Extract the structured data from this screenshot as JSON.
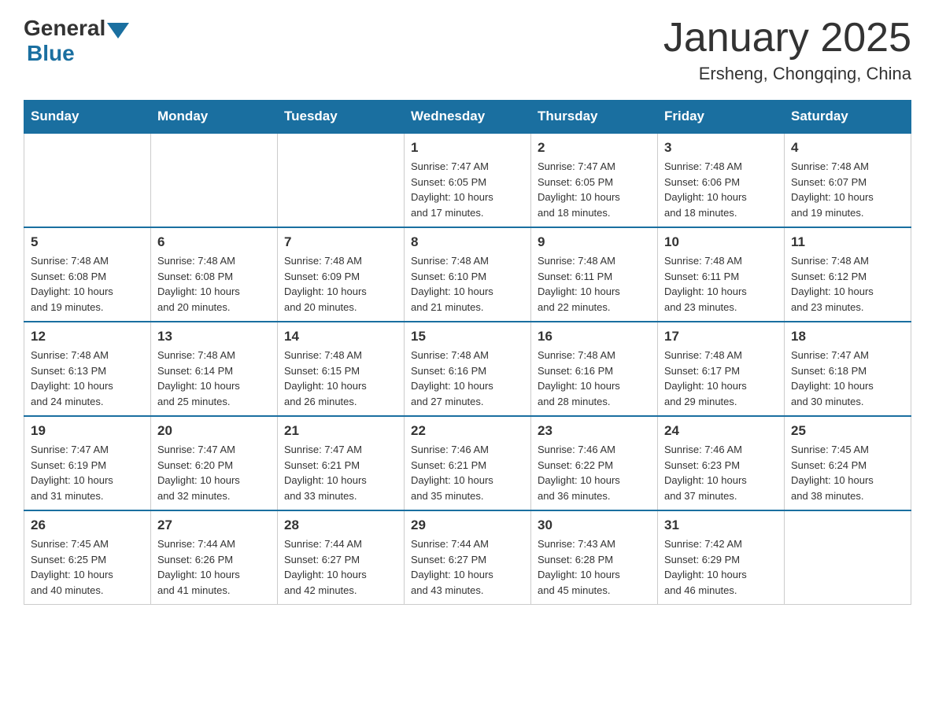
{
  "header": {
    "logo_general": "General",
    "logo_blue": "Blue",
    "title": "January 2025",
    "subtitle": "Ersheng, Chongqing, China"
  },
  "weekdays": [
    "Sunday",
    "Monday",
    "Tuesday",
    "Wednesday",
    "Thursday",
    "Friday",
    "Saturday"
  ],
  "weeks": [
    [
      {
        "day": "",
        "info": ""
      },
      {
        "day": "",
        "info": ""
      },
      {
        "day": "",
        "info": ""
      },
      {
        "day": "1",
        "info": "Sunrise: 7:47 AM\nSunset: 6:05 PM\nDaylight: 10 hours\nand 17 minutes."
      },
      {
        "day": "2",
        "info": "Sunrise: 7:47 AM\nSunset: 6:05 PM\nDaylight: 10 hours\nand 18 minutes."
      },
      {
        "day": "3",
        "info": "Sunrise: 7:48 AM\nSunset: 6:06 PM\nDaylight: 10 hours\nand 18 minutes."
      },
      {
        "day": "4",
        "info": "Sunrise: 7:48 AM\nSunset: 6:07 PM\nDaylight: 10 hours\nand 19 minutes."
      }
    ],
    [
      {
        "day": "5",
        "info": "Sunrise: 7:48 AM\nSunset: 6:08 PM\nDaylight: 10 hours\nand 19 minutes."
      },
      {
        "day": "6",
        "info": "Sunrise: 7:48 AM\nSunset: 6:08 PM\nDaylight: 10 hours\nand 20 minutes."
      },
      {
        "day": "7",
        "info": "Sunrise: 7:48 AM\nSunset: 6:09 PM\nDaylight: 10 hours\nand 20 minutes."
      },
      {
        "day": "8",
        "info": "Sunrise: 7:48 AM\nSunset: 6:10 PM\nDaylight: 10 hours\nand 21 minutes."
      },
      {
        "day": "9",
        "info": "Sunrise: 7:48 AM\nSunset: 6:11 PM\nDaylight: 10 hours\nand 22 minutes."
      },
      {
        "day": "10",
        "info": "Sunrise: 7:48 AM\nSunset: 6:11 PM\nDaylight: 10 hours\nand 23 minutes."
      },
      {
        "day": "11",
        "info": "Sunrise: 7:48 AM\nSunset: 6:12 PM\nDaylight: 10 hours\nand 23 minutes."
      }
    ],
    [
      {
        "day": "12",
        "info": "Sunrise: 7:48 AM\nSunset: 6:13 PM\nDaylight: 10 hours\nand 24 minutes."
      },
      {
        "day": "13",
        "info": "Sunrise: 7:48 AM\nSunset: 6:14 PM\nDaylight: 10 hours\nand 25 minutes."
      },
      {
        "day": "14",
        "info": "Sunrise: 7:48 AM\nSunset: 6:15 PM\nDaylight: 10 hours\nand 26 minutes."
      },
      {
        "day": "15",
        "info": "Sunrise: 7:48 AM\nSunset: 6:16 PM\nDaylight: 10 hours\nand 27 minutes."
      },
      {
        "day": "16",
        "info": "Sunrise: 7:48 AM\nSunset: 6:16 PM\nDaylight: 10 hours\nand 28 minutes."
      },
      {
        "day": "17",
        "info": "Sunrise: 7:48 AM\nSunset: 6:17 PM\nDaylight: 10 hours\nand 29 minutes."
      },
      {
        "day": "18",
        "info": "Sunrise: 7:47 AM\nSunset: 6:18 PM\nDaylight: 10 hours\nand 30 minutes."
      }
    ],
    [
      {
        "day": "19",
        "info": "Sunrise: 7:47 AM\nSunset: 6:19 PM\nDaylight: 10 hours\nand 31 minutes."
      },
      {
        "day": "20",
        "info": "Sunrise: 7:47 AM\nSunset: 6:20 PM\nDaylight: 10 hours\nand 32 minutes."
      },
      {
        "day": "21",
        "info": "Sunrise: 7:47 AM\nSunset: 6:21 PM\nDaylight: 10 hours\nand 33 minutes."
      },
      {
        "day": "22",
        "info": "Sunrise: 7:46 AM\nSunset: 6:21 PM\nDaylight: 10 hours\nand 35 minutes."
      },
      {
        "day": "23",
        "info": "Sunrise: 7:46 AM\nSunset: 6:22 PM\nDaylight: 10 hours\nand 36 minutes."
      },
      {
        "day": "24",
        "info": "Sunrise: 7:46 AM\nSunset: 6:23 PM\nDaylight: 10 hours\nand 37 minutes."
      },
      {
        "day": "25",
        "info": "Sunrise: 7:45 AM\nSunset: 6:24 PM\nDaylight: 10 hours\nand 38 minutes."
      }
    ],
    [
      {
        "day": "26",
        "info": "Sunrise: 7:45 AM\nSunset: 6:25 PM\nDaylight: 10 hours\nand 40 minutes."
      },
      {
        "day": "27",
        "info": "Sunrise: 7:44 AM\nSunset: 6:26 PM\nDaylight: 10 hours\nand 41 minutes."
      },
      {
        "day": "28",
        "info": "Sunrise: 7:44 AM\nSunset: 6:27 PM\nDaylight: 10 hours\nand 42 minutes."
      },
      {
        "day": "29",
        "info": "Sunrise: 7:44 AM\nSunset: 6:27 PM\nDaylight: 10 hours\nand 43 minutes."
      },
      {
        "day": "30",
        "info": "Sunrise: 7:43 AM\nSunset: 6:28 PM\nDaylight: 10 hours\nand 45 minutes."
      },
      {
        "day": "31",
        "info": "Sunrise: 7:42 AM\nSunset: 6:29 PM\nDaylight: 10 hours\nand 46 minutes."
      },
      {
        "day": "",
        "info": ""
      }
    ]
  ]
}
